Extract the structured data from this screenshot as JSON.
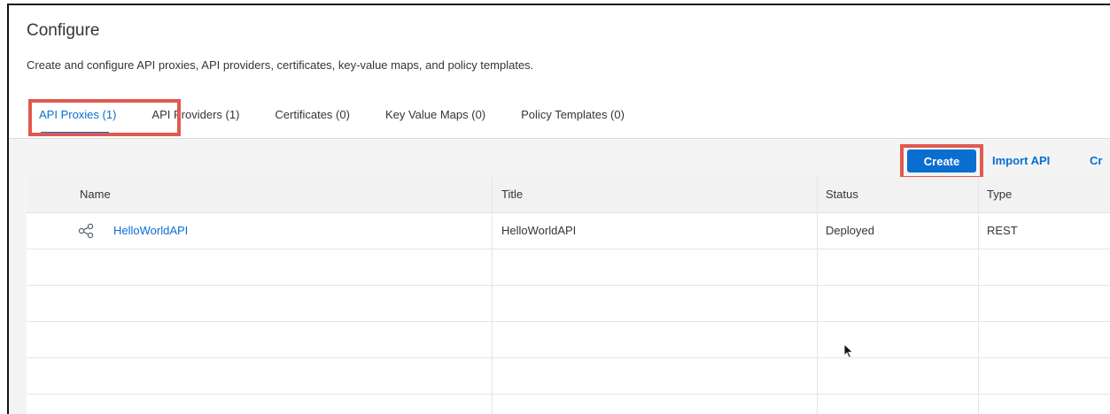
{
  "page": {
    "title": "Configure",
    "description": "Create and configure API proxies, API providers, certificates, key-value maps, and policy templates."
  },
  "tabs": [
    {
      "label": "API Proxies (1)",
      "active": true
    },
    {
      "label": "API Providers (1)",
      "active": false
    },
    {
      "label": "Certificates (0)",
      "active": false
    },
    {
      "label": "Key Value Maps (0)",
      "active": false
    },
    {
      "label": "Policy Templates (0)",
      "active": false
    }
  ],
  "toolbar": {
    "create_label": "Create",
    "import_label": "Import API",
    "truncated_label": "Cr"
  },
  "table": {
    "columns": [
      "Name",
      "Title",
      "Status",
      "Type"
    ],
    "rows": [
      {
        "name": "HelloWorldAPI",
        "title": "HelloWorldAPI",
        "status": "Deployed",
        "type": "REST",
        "icon": "share-icon"
      }
    ]
  },
  "colors": {
    "accent": "#0a6ed1",
    "highlight": "#e05a4f",
    "text": "#32363a"
  }
}
